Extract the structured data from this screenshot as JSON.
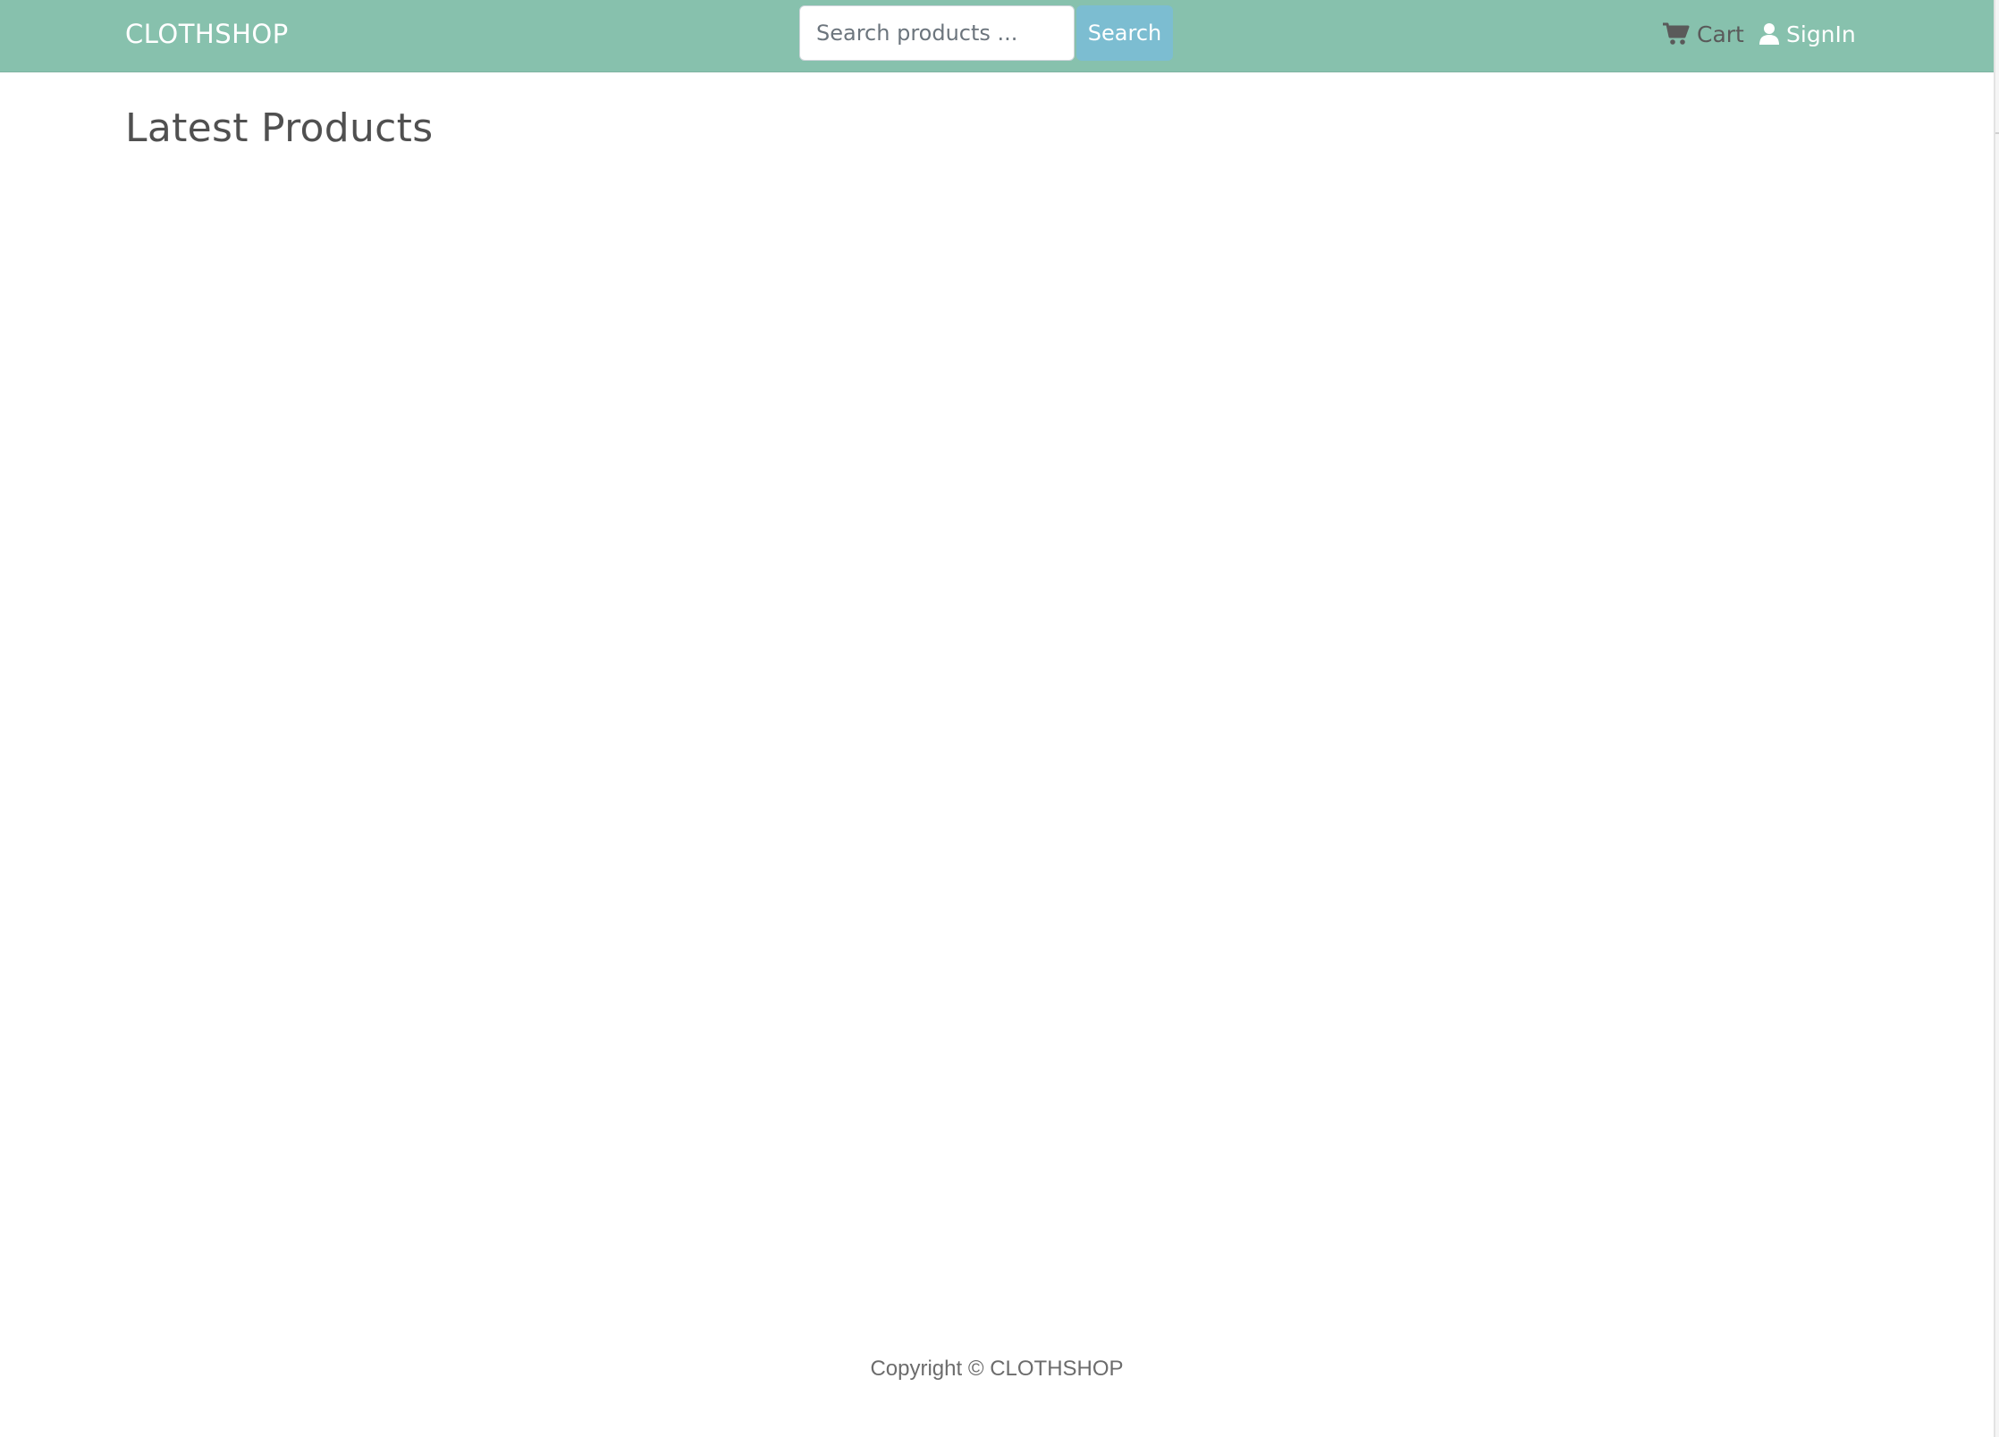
{
  "navbar": {
    "brand": "CLOTHSHOP",
    "search": {
      "placeholder": "Search products ...",
      "value": "",
      "button_label": "Search"
    },
    "links": {
      "cart": "Cart",
      "signin": "SignIn"
    },
    "colors": {
      "background": "#87c1ad",
      "search_button": "#7cbdd1"
    },
    "icons": {
      "cart": "cart-icon",
      "signin": "user-icon"
    }
  },
  "main": {
    "heading": "Latest Products"
  },
  "footer": {
    "copyright": "Copyright © CLOTHSHOP"
  }
}
